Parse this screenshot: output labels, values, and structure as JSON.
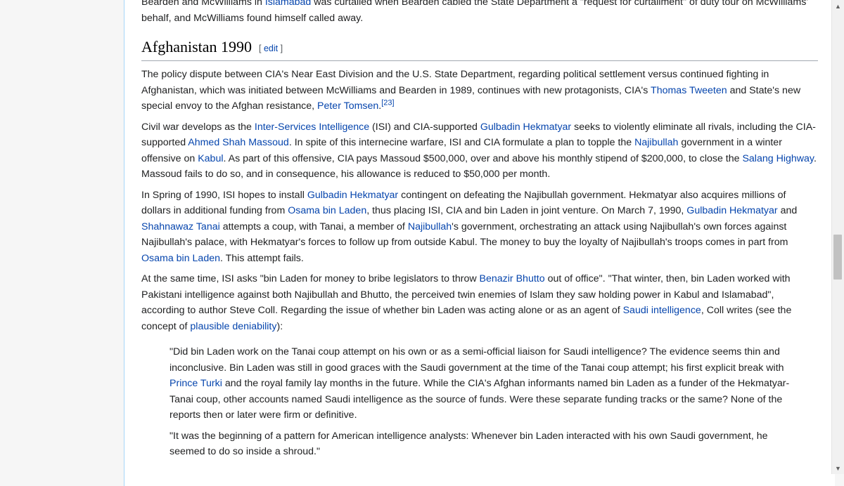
{
  "intro_fragment": {
    "t1": "Bearden and McWilliams in ",
    "l1": "Islamabad",
    "t2": " was curtailed when Bearden cabled the State Department a \"request for curtailment\" of duty tour on McWilliams' behalf, and McWilliams found himself called away."
  },
  "section": {
    "title": "Afghanistan 1990",
    "edit_open": "[ ",
    "edit_label": "edit",
    "edit_close": " ]"
  },
  "p1": {
    "t1": "The policy dispute between CIA's Near East Division and the U.S. State Department, regarding political settlement versus continued fighting in Afghanistan, which was initiated between McWilliams and Bearden in 1989, continues with new protagonists, CIA's ",
    "l1": "Thomas Tweeten",
    "t2": " and State's new special envoy to the Afghan resistance, ",
    "l2": "Peter Tomsen",
    "t3": ".",
    "ref": "[23]"
  },
  "p2": {
    "t1": "Civil war develops as the ",
    "l1": "Inter-Services Intelligence",
    "t2": " (ISI) and CIA-supported ",
    "l2": "Gulbadin Hekmatyar",
    "t3": " seeks to violently eliminate all rivals, including the CIA-supported ",
    "l3": "Ahmed Shah Massoud",
    "t4": ". In spite of this internecine warfare, ISI and CIA formulate a plan to topple the ",
    "l4": "Najibullah",
    "t5": " government in a winter offensive on ",
    "l5": "Kabul",
    "t6": ". As part of this offensive, CIA pays Massoud $500,000, over and above his monthly stipend of $200,000, to close the ",
    "l6": "Salang Highway",
    "t7": ". Massoud fails to do so, and in consequence, his allowance is reduced to $50,000 per month."
  },
  "p3": {
    "t1": "In Spring of 1990, ISI hopes to install ",
    "l1": "Gulbadin Hekmatyar",
    "t2": " contingent on defeating the Najibullah government. Hekmatyar also acquires millions of dollars in additional funding from ",
    "l2": "Osama bin Laden",
    "t3": ", thus placing ISI, CIA and bin Laden in joint venture. On March 7, 1990, ",
    "l3": "Gulbadin Hekmatyar",
    "t4": " and ",
    "l4": "Shahnawaz Tanai",
    "t5": " attempts a coup, with Tanai, a member of ",
    "l5": "Najibullah",
    "t6": "'s government, orchestrating an attack using Najibullah's own forces against Najibullah's palace, with Hekmatyar's forces to follow up from outside Kabul. The money to buy the loyalty of Najibullah's troops comes in part from ",
    "l6": "Osama bin Laden",
    "t7": ". This attempt fails."
  },
  "p4": {
    "t1": "At the same time, ISI asks \"bin Laden for money to bribe legislators to throw ",
    "l1": "Benazir Bhutto",
    "t2": " out of office\". \"That winter, then, bin Laden worked with Pakistani intelligence against both Najibullah and Bhutto, the perceived twin enemies of Islam they saw holding power in Kabul and Islamabad\", according to author Steve Coll. Regarding the issue of whether bin Laden was acting alone or as an agent of ",
    "l2": "Saudi intelligence",
    "t3": ", Coll writes (see the concept of ",
    "l3": "plausible deniability",
    "t4": "):"
  },
  "quote1": {
    "t1": "\"Did bin Laden work on the Tanai coup attempt on his own or as a semi-official liaison for Saudi intelligence? The evidence seems thin and inconclusive. Bin Laden was still in good graces with the Saudi government at the time of the Tanai coup attempt; his first explicit break with ",
    "l1": "Prince Turki",
    "t2": " and the royal family lay months in the future. While the CIA's Afghan informants named bin Laden as a funder of the Hekmatyar-Tanai coup, other accounts named Saudi intelligence as the source of funds. Were these separate funding tracks or the same? None of the reports then or later were firm or definitive."
  },
  "quote2": {
    "t1": "\"It was the beginning of a pattern for American intelligence analysts: Whenever bin Laden interacted with his own Saudi government, he seemed to do so inside a shroud.\""
  },
  "scrollbar": {
    "up_icon": "▲",
    "down_icon": "▼",
    "position": 0.55
  },
  "colors": {
    "link": "#0645ad",
    "text": "#202122",
    "page_bg": "#f6f6f6"
  }
}
